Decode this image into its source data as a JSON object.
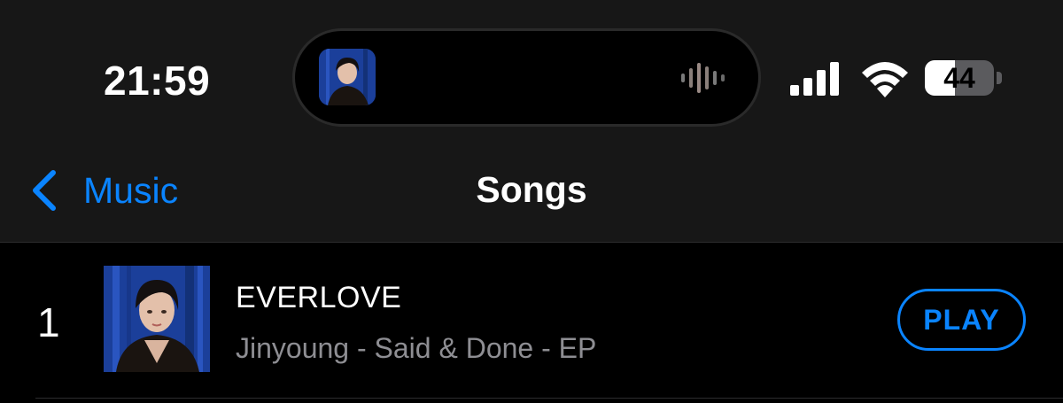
{
  "status_bar": {
    "time": "21:59",
    "battery_level": "44",
    "battery_percent": 44
  },
  "nav": {
    "back_label": "Music",
    "title": "Songs"
  },
  "songs": [
    {
      "rank": "1",
      "title": "EVERLOVE",
      "subtitle": "Jinyoung - Said & Done - EP",
      "action_label": "PLAY"
    }
  ],
  "colors": {
    "accent": "#0a84ff",
    "header_bg": "#171717",
    "list_bg": "#000000",
    "secondary_text": "#8e8e93",
    "artwork_bg": "#1b3f9a"
  },
  "icons": {
    "back": "chevron-left-icon",
    "signal": "cellular-signal-icon",
    "wifi": "wifi-icon",
    "battery": "battery-icon",
    "waveform": "audio-waveform-icon",
    "album_art": "album-art-portrait"
  }
}
